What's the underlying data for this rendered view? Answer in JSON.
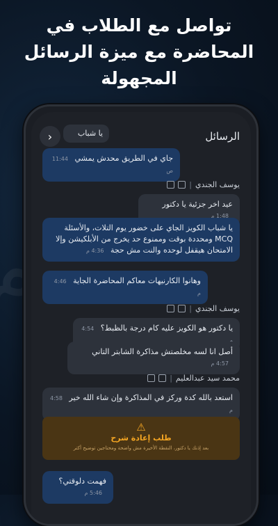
{
  "headline": {
    "line1": "تواصل مع الطلاب في",
    "line2": "المحاضرة مع ميزة الرسائل",
    "line3": "المجهولة"
  },
  "chat": {
    "title": "الرسائل",
    "back_icon": "chevron-right-icon",
    "messages": [
      {
        "text": "يا شباب",
        "time": ""
      },
      {
        "text": "جاي في الطريق محدش يمشي",
        "time": "11:44 ص"
      },
      {
        "sender": "يوسف الجندي"
      },
      {
        "text": "عيد اخر جزئية يا دكتور",
        "time": "1:48 م"
      },
      {
        "text": "يا شباب الكويز الجاي على خضور يوم التلات، والأسئلة MCQ ومحددة بوقت وممنوع حد يخرج من الأبلكيشن وإلا الامتحان هيقفل لوحده والنت مش حجة",
        "time": "4:36 م"
      },
      {
        "text": "وهانوا الكارنيهات معاكم المحاضرة الجاية",
        "time": "4:46 م"
      },
      {
        "sender": "يوسف الجندي"
      },
      {
        "text": "يا دكتور هو الكويز عليه كام درجة بالظبط؟",
        "time": "4:54 م"
      },
      {
        "text": "أصل انا لسه مخلصتش مذاكرة الشابتر التاني",
        "time": "4:57 م"
      },
      {
        "sender": "محمد سيد عبدالعليم"
      },
      {
        "text": "استعد بالله كدة وركز في المذاكرة وإن شاء الله خير",
        "time": "4:58 م"
      },
      {
        "text": "فهمت دلوقتي؟",
        "time": "5:46 م"
      }
    ],
    "warning": {
      "title": "طلب إعادة شرح",
      "subtitle": "بعد إذنك يا دكتور، النقطة الأخيرة مش واضحة ومحتاجين توضيح أكتر"
    }
  }
}
